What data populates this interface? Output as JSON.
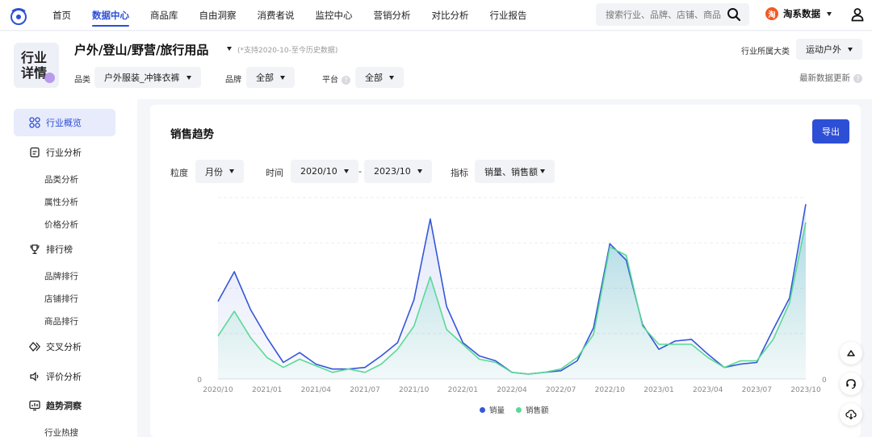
{
  "nav": {
    "items": [
      "首页",
      "数据中心",
      "商品库",
      "自由洞察",
      "消费者说",
      "监控中心",
      "营销分析",
      "对比分析",
      "行业报告"
    ],
    "active_index": 1,
    "search_placeholder": "搜索行业、品牌、店铺、商品",
    "data_badge": "淘",
    "data_label": "淘系数据"
  },
  "header": {
    "badge_line1": "行业",
    "badge_line2": "详情",
    "title": "户外/登山/野营/旅行用品",
    "note": "(*支持2020-10-至今历史数据)",
    "category_label": "行业所属大类",
    "category_value": "运动户外",
    "filters": {
      "category_label": "品类",
      "category_value": "户外服装_冲锋衣裤",
      "brand_label": "品牌",
      "brand_value": "全部",
      "platform_label": "平台",
      "platform_value": "全部"
    },
    "latest_update": "最新数据更新",
    "help_glyph": "?"
  },
  "sidebar": {
    "overview": "行业概览",
    "analysis": "行业分析",
    "analysis_subs": [
      "品类分析",
      "属性分析",
      "价格分析"
    ],
    "ranking": "排行榜",
    "ranking_subs": [
      "品牌排行",
      "店铺排行",
      "商品排行"
    ],
    "cross": "交叉分析",
    "review": "评价分析",
    "trend": "趋势洞察",
    "trend_subs": [
      "行业热搜"
    ]
  },
  "main": {
    "title": "销售趋势",
    "export_label": "导出",
    "granularity_label": "粒度",
    "granularity_value": "月份",
    "time_label": "时间",
    "time_start": "2020/10",
    "time_sep": "-",
    "time_end": "2023/10",
    "metric_label": "指标",
    "metric_value": "销量、销售额"
  },
  "colors": {
    "accent": "#2d4fd6",
    "series_volume": "#3456d8",
    "series_amount": "#5ad996"
  },
  "chart_data": {
    "type": "line",
    "x_tick_labels": [
      "2020/10",
      "2021/01",
      "2021/04",
      "2021/07",
      "2021/10",
      "2022/01",
      "2022/04",
      "2022/07",
      "2022/10",
      "2023/01",
      "2023/04",
      "2023/07",
      "2023/10"
    ],
    "y_left_ticks": [
      "0"
    ],
    "y_right_ticks": [
      "0"
    ],
    "grid": true,
    "legend": "bottom-center",
    "series": [
      {
        "name": "销量",
        "values": [
          47,
          65,
          42,
          25,
          10,
          16,
          9,
          6,
          6,
          7,
          14,
          22,
          48,
          97,
          44,
          22,
          14,
          11,
          4,
          3,
          4,
          5,
          11,
          31,
          82,
          72,
          33,
          18,
          23,
          24,
          15,
          7,
          9,
          10,
          30,
          49,
          106
        ]
      },
      {
        "name": "销售额",
        "values": [
          26,
          41,
          25,
          13,
          7,
          12,
          8,
          4,
          6,
          4,
          9,
          18,
          32,
          62,
          30,
          21,
          12,
          10,
          4,
          3,
          4,
          6,
          13,
          27,
          80,
          75,
          32,
          21,
          21,
          21,
          13,
          7,
          11,
          11,
          24,
          46,
          95
        ]
      }
    ]
  }
}
